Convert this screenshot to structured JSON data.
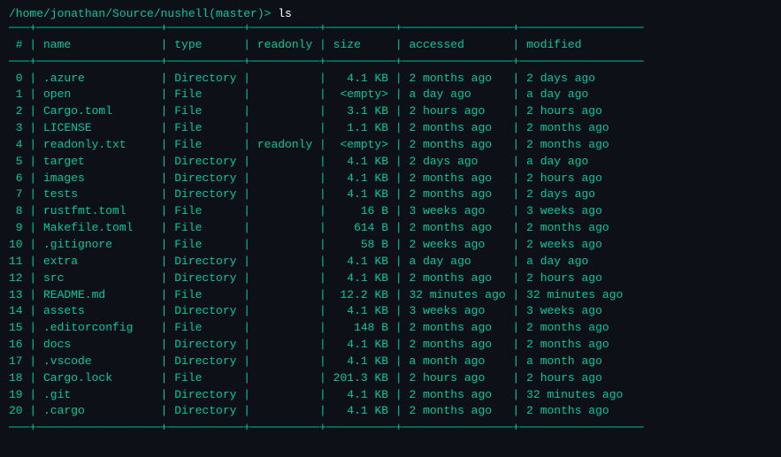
{
  "prompt": {
    "path": "/home/jonathan/Source/nushell(master)>",
    "command": " ls"
  },
  "top_divider": "───+──────────────────+───────────+──────────+──────────+────────────────+──────────────────",
  "header": {
    "index": "#",
    "name": "name",
    "type": "type",
    "readonly": "readonly",
    "size": "size",
    "accessed": "accessed",
    "modified": "modified"
  },
  "header_divider": "───+──────────────────+───────────+──────────+──────────+────────────────+──────────────────",
  "rows": [
    {
      "index": "0",
      "name": ".azure",
      "type": "Directory",
      "readonly": "",
      "size": "4.1 KB",
      "accessed": "2 months ago",
      "modified": "2 days ago"
    },
    {
      "index": "1",
      "name": "open",
      "type": "File",
      "readonly": "",
      "size": "<empty>",
      "accessed": "a day ago",
      "modified": "a day ago"
    },
    {
      "index": "2",
      "name": "Cargo.toml",
      "type": "File",
      "readonly": "",
      "size": "3.1 KB",
      "accessed": "2 hours ago",
      "modified": "2 hours ago"
    },
    {
      "index": "3",
      "name": "LICENSE",
      "type": "File",
      "readonly": "",
      "size": "1.1 KB",
      "accessed": "2 months ago",
      "modified": "2 months ago"
    },
    {
      "index": "4",
      "name": "readonly.txt",
      "type": "File",
      "readonly": "readonly",
      "size": "<empty>",
      "accessed": "2 months ago",
      "modified": "2 months ago"
    },
    {
      "index": "5",
      "name": "target",
      "type": "Directory",
      "readonly": "",
      "size": "4.1 KB",
      "accessed": "2 days ago",
      "modified": "a day ago"
    },
    {
      "index": "6",
      "name": "images",
      "type": "Directory",
      "readonly": "",
      "size": "4.1 KB",
      "accessed": "2 months ago",
      "modified": "2 hours ago"
    },
    {
      "index": "7",
      "name": "tests",
      "type": "Directory",
      "readonly": "",
      "size": "4.1 KB",
      "accessed": "2 months ago",
      "modified": "2 days ago"
    },
    {
      "index": "8",
      "name": "rustfmt.toml",
      "type": "File",
      "readonly": "",
      "size": "16 B",
      "accessed": "3 weeks ago",
      "modified": "3 weeks ago"
    },
    {
      "index": "9",
      "name": "Makefile.toml",
      "type": "File",
      "readonly": "",
      "size": "614 B",
      "accessed": "2 months ago",
      "modified": "2 months ago"
    },
    {
      "index": "10",
      "name": ".gitignore",
      "type": "File",
      "readonly": "",
      "size": "58 B",
      "accessed": "2 weeks ago",
      "modified": "2 weeks ago"
    },
    {
      "index": "11",
      "name": "extra",
      "type": "Directory",
      "readonly": "",
      "size": "4.1 KB",
      "accessed": "a day ago",
      "modified": "a day ago"
    },
    {
      "index": "12",
      "name": "src",
      "type": "Directory",
      "readonly": "",
      "size": "4.1 KB",
      "accessed": "2 months ago",
      "modified": "2 hours ago"
    },
    {
      "index": "13",
      "name": "README.md",
      "type": "File",
      "readonly": "",
      "size": "12.2 KB",
      "accessed": "32 minutes ago",
      "modified": "32 minutes ago"
    },
    {
      "index": "14",
      "name": "assets",
      "type": "Directory",
      "readonly": "",
      "size": "4.1 KB",
      "accessed": "3 weeks ago",
      "modified": "3 weeks ago"
    },
    {
      "index": "15",
      "name": ".editorconfig",
      "type": "File",
      "readonly": "",
      "size": "148 B",
      "accessed": "2 months ago",
      "modified": "2 months ago"
    },
    {
      "index": "16",
      "name": "docs",
      "type": "Directory",
      "readonly": "",
      "size": "4.1 KB",
      "accessed": "2 months ago",
      "modified": "2 months ago"
    },
    {
      "index": "17",
      "name": ".vscode",
      "type": "Directory",
      "readonly": "",
      "size": "4.1 KB",
      "accessed": "a month ago",
      "modified": "a month ago"
    },
    {
      "index": "18",
      "name": "Cargo.lock",
      "type": "File",
      "readonly": "",
      "size": "201.3 KB",
      "accessed": "2 hours ago",
      "modified": "2 hours ago"
    },
    {
      "index": "19",
      "name": ".git",
      "type": "Directory",
      "readonly": "",
      "size": "4.1 KB",
      "accessed": "2 months ago",
      "modified": "32 minutes ago"
    },
    {
      "index": "20",
      "name": ".cargo",
      "type": "Directory",
      "readonly": "",
      "size": "4.1 KB",
      "accessed": "2 months ago",
      "modified": "2 months ago"
    }
  ],
  "bottom_divider": "───+──────────────────+───────────+──────────+──────────+────────────────+──────────────────"
}
